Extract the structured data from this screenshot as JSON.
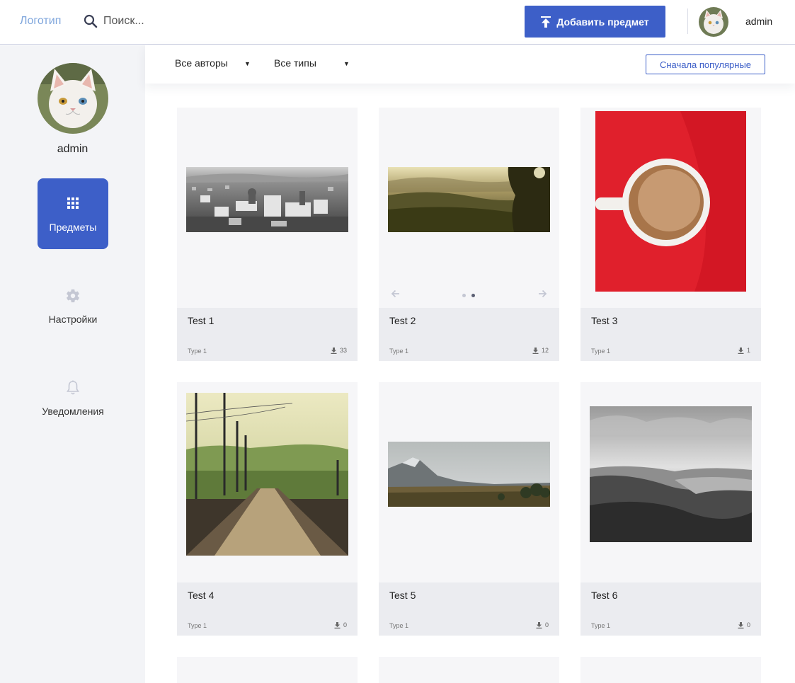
{
  "header": {
    "logo": "Логотип",
    "search_placeholder": "Поиск...",
    "add_button": "Добавить предмет",
    "username": "admin"
  },
  "sidebar": {
    "username": "admin",
    "items": [
      {
        "label": "Предметы",
        "icon": "grid-icon",
        "active": true
      },
      {
        "label": "Настройки",
        "icon": "gear-icon",
        "active": false
      },
      {
        "label": "Уведомления",
        "icon": "bell-icon",
        "active": false
      }
    ]
  },
  "filters": {
    "authors": "Все авторы",
    "types": "Все типы",
    "sort": "Сначала популярные"
  },
  "cards": [
    {
      "title": "Test 1",
      "type": "Type 1",
      "downloads": "33"
    },
    {
      "title": "Test 2",
      "type": "Type 1",
      "downloads": "12",
      "carousel_pages": 2,
      "carousel_active": 2
    },
    {
      "title": "Test 3",
      "type": "Type 1",
      "downloads": "1"
    },
    {
      "title": "Test 4",
      "type": "Type 1",
      "downloads": "0"
    },
    {
      "title": "Test 5",
      "type": "Type 1",
      "downloads": "0"
    },
    {
      "title": "Test 6",
      "type": "Type 1",
      "downloads": "0"
    }
  ],
  "colors": {
    "accent": "#3d5fc8",
    "logo": "#7fa6dc",
    "sidebar_bg": "#f3f4f7",
    "card_bg": "#f6f6f8",
    "card_info_bg": "#ebecf0"
  }
}
